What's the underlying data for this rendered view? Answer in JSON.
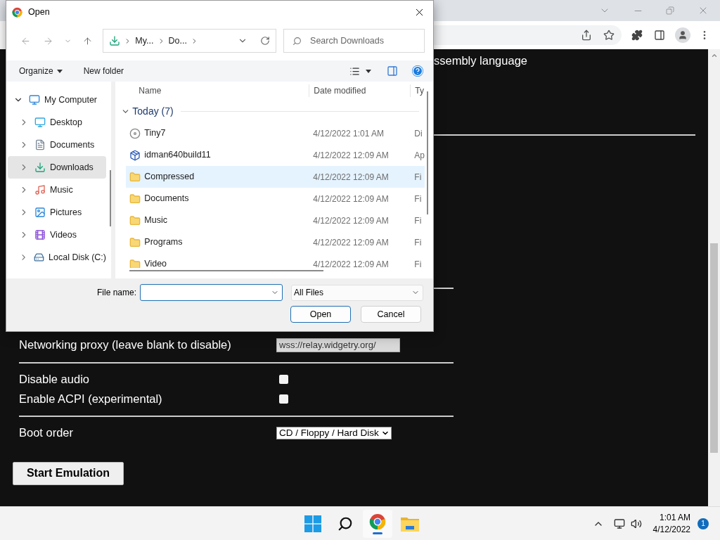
{
  "dialog": {
    "title": "Open",
    "breadcrumb": [
      "My...",
      "Do..."
    ],
    "search_placeholder": "Search Downloads",
    "organize": "Organize",
    "new_folder": "New folder",
    "tree": [
      {
        "label": "My Computer",
        "kind": "computer",
        "expanded": true,
        "selected": false,
        "children": [
          {
            "label": "Desktop",
            "kind": "desktop",
            "expanded": false,
            "selected": false
          },
          {
            "label": "Documents",
            "kind": "documents",
            "expanded": false,
            "selected": false
          },
          {
            "label": "Downloads",
            "kind": "downloads",
            "expanded": false,
            "selected": true
          },
          {
            "label": "Music",
            "kind": "music",
            "expanded": false,
            "selected": false
          },
          {
            "label": "Pictures",
            "kind": "pictures",
            "expanded": false,
            "selected": false
          },
          {
            "label": "Videos",
            "kind": "videos",
            "expanded": false,
            "selected": false
          },
          {
            "label": "Local Disk (C:)",
            "kind": "disk",
            "expanded": false,
            "selected": false
          }
        ]
      }
    ],
    "columns": [
      "Name",
      "Date modified",
      "Ty"
    ],
    "group": {
      "label": "Today (7)",
      "expanded": true
    },
    "files": [
      {
        "name": "Tiny7",
        "kind": "disc",
        "date": "4/12/2022 1:01 AM",
        "type": "Di",
        "selected": false
      },
      {
        "name": "idman640build11",
        "kind": "installer",
        "date": "4/12/2022 12:09 AM",
        "type": "Ap",
        "selected": false
      },
      {
        "name": "Compressed",
        "kind": "folder",
        "date": "4/12/2022 12:09 AM",
        "type": "Fi",
        "selected": true
      },
      {
        "name": "Documents",
        "kind": "folder",
        "date": "4/12/2022 12:09 AM",
        "type": "Fi",
        "selected": false
      },
      {
        "name": "Music",
        "kind": "folder",
        "date": "4/12/2022 12:09 AM",
        "type": "Fi",
        "selected": false
      },
      {
        "name": "Programs",
        "kind": "folder",
        "date": "4/12/2022 12:09 AM",
        "type": "Fi",
        "selected": false
      },
      {
        "name": "Video",
        "kind": "folder",
        "date": "4/12/2022 12:09 AM",
        "type": "Fi",
        "selected": false
      }
    ],
    "file_name_label": "File name:",
    "filter": "All Files",
    "buttons": [
      "Open",
      "Cancel"
    ]
  },
  "page": {
    "heading_fragment": "ssembly language",
    "sections": [
      [
        {
          "kind": "text",
          "label": "Networking proxy (leave blank to disable)",
          "value": "wss://relay.widgetry.org/"
        }
      ],
      [
        {
          "kind": "checkbox",
          "label": "Disable audio",
          "checked": false
        },
        {
          "kind": "checkbox",
          "label": "Enable ACPI (experimental)",
          "checked": false
        }
      ],
      [
        {
          "kind": "select",
          "label": "Boot order",
          "value": "CD / Floppy / Hard Disk"
        }
      ]
    ],
    "start_button": "Start Emulation"
  },
  "taskbar": {
    "time": "1:01 AM",
    "date": "4/12/2022",
    "notifications": "1"
  }
}
